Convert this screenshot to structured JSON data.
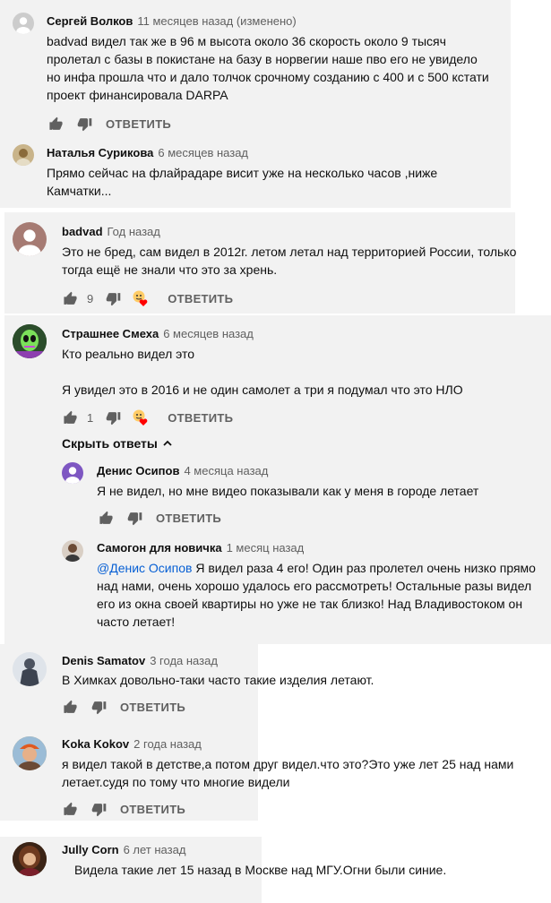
{
  "comments": [
    {
      "author": "Сергей Волков",
      "time": "11 месяцев назад (изменено)",
      "lines": [
        "badvad видел так же в 96 м высота около 36 скорость около 9 тысяч",
        "пролетал с базы в покистане на базу в норвегии наше пво его не увидело",
        "но инфа прошла что и дало толчок срочному созданию с 400 и с 500 кстати",
        "проект финансировала DARPA"
      ]
    },
    {
      "author": "Наталья Сурикова",
      "time": "6 месяцев назад",
      "lines": [
        "Прямо сейчас на флайрадаре  висит уже на несколько часов ,ниже",
        "Камчатки..."
      ]
    },
    {
      "author": "badvad",
      "time": "Год назад",
      "lines": [
        "Это не бред, сам видел в 2012г. летом летал над территорией России, только",
        "тогда ещё не знали что это за хрень."
      ],
      "likes": "9"
    },
    {
      "author": "Страшнее Смеха",
      "time": "6 месяцев назад",
      "lines": [
        "Кто реально видел это",
        "",
        "Я увидел это в 2016 и не один самолет а три я подумал что это НЛО"
      ],
      "likes": "1"
    },
    {
      "author": "Денис Осипов",
      "time": "4 месяца назад",
      "lines": [
        "Я не видел, но мне видео показывали как у меня в городе летает"
      ]
    },
    {
      "author": "Самогон для новичка",
      "time": "1 месяц назад",
      "mention": "@Денис Осипов",
      "lines": [
        " Я видел раза 4 его! Один раз пролетел очень низко прямо",
        "над нами, очень хорошо удалось его рассмотреть! Остальные разы видел",
        "его из окна своей квартиры но уже не так близко! Над Владивостоком он",
        "часто летает!"
      ]
    },
    {
      "author": "Denis Samatov",
      "time": "3 года назад",
      "lines": [
        "В Химках довольно-таки часто такие изделия летают."
      ]
    },
    {
      "author": "Koka Kokov",
      "time": "2 года назад",
      "lines": [
        "я видел такой в детстве,а потом друг видел.что это?Это уже лет 25 над нами",
        "летает.судя по тому что многие видели"
      ]
    },
    {
      "author": "Jully Corn",
      "time": "6 лет назад",
      "lines": [
        "Видела такие лет 15 назад в Москве над МГУ.Огни были синие."
      ]
    }
  ],
  "reply_label": "ОТВЕТИТЬ",
  "hide_replies_label": "Скрыть ответы",
  "colors": {
    "highlight_bg": "#f2f2f2",
    "mention": "#065fd4",
    "secondary_text": "#606060",
    "heart": "#ff0000"
  }
}
